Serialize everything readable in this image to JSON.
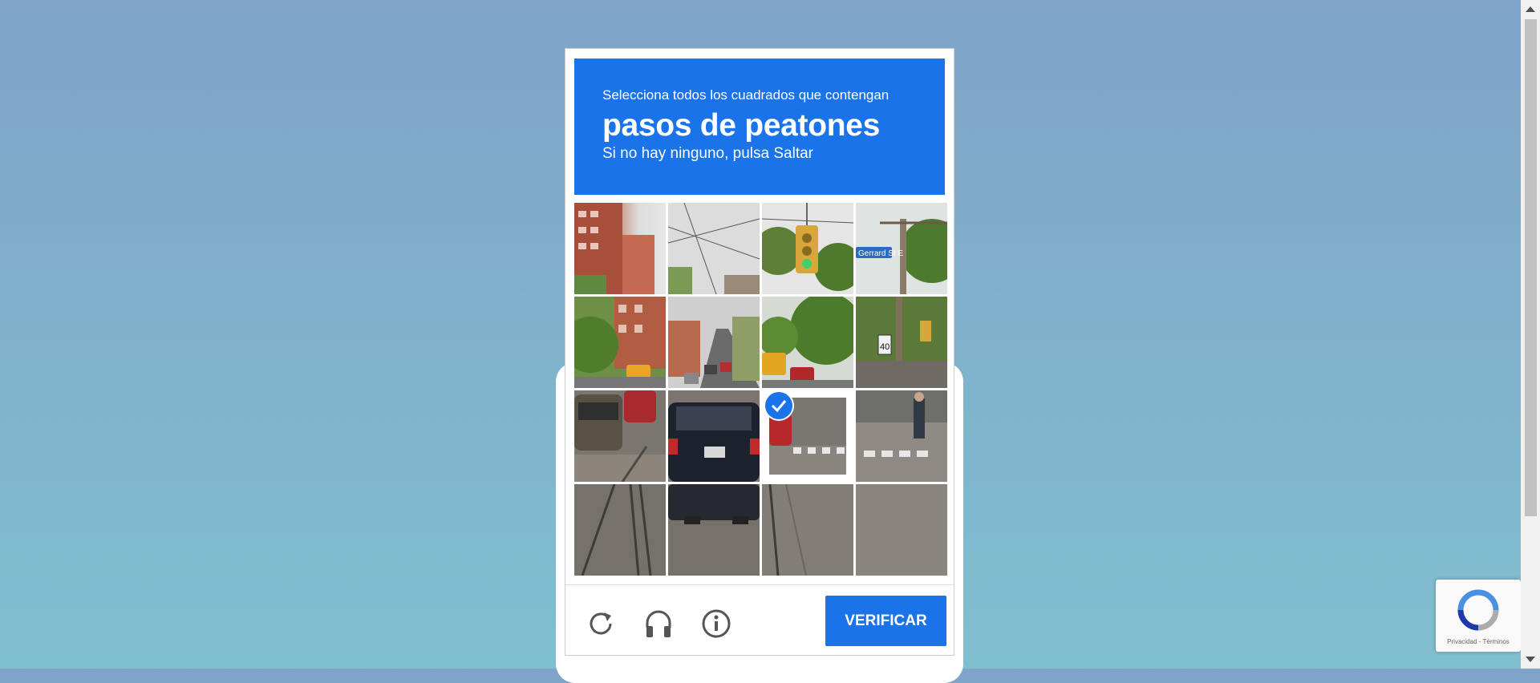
{
  "challenge": {
    "instruction_line1": "Selecciona todos los cuadrados que contengan",
    "target_object": "pasos de peatones",
    "instruction_line3": "Si no hay ninguno, pulsa Saltar",
    "tiles": [
      {
        "row": 1,
        "col": 1,
        "selected": false
      },
      {
        "row": 1,
        "col": 2,
        "selected": false
      },
      {
        "row": 1,
        "col": 3,
        "selected": false
      },
      {
        "row": 1,
        "col": 4,
        "selected": false
      },
      {
        "row": 2,
        "col": 1,
        "selected": false
      },
      {
        "row": 2,
        "col": 2,
        "selected": false
      },
      {
        "row": 2,
        "col": 3,
        "selected": false
      },
      {
        "row": 2,
        "col": 4,
        "selected": false
      },
      {
        "row": 3,
        "col": 1,
        "selected": false
      },
      {
        "row": 3,
        "col": 2,
        "selected": false
      },
      {
        "row": 3,
        "col": 3,
        "selected": true
      },
      {
        "row": 3,
        "col": 4,
        "selected": false
      },
      {
        "row": 4,
        "col": 1,
        "selected": false
      },
      {
        "row": 4,
        "col": 2,
        "selected": false
      },
      {
        "row": 4,
        "col": 3,
        "selected": false
      },
      {
        "row": 4,
        "col": 4,
        "selected": false
      }
    ],
    "street_sign_text": "Gerrard St E",
    "speed_limit_text": "40"
  },
  "footer": {
    "reload_icon": "reload-icon",
    "audio_icon": "headphones-icon",
    "info_icon": "info-icon",
    "verify_label": "VERIFICAR"
  },
  "badge": {
    "label": "Privacidad - Términos"
  },
  "colors": {
    "accent": "#1a73e8"
  }
}
